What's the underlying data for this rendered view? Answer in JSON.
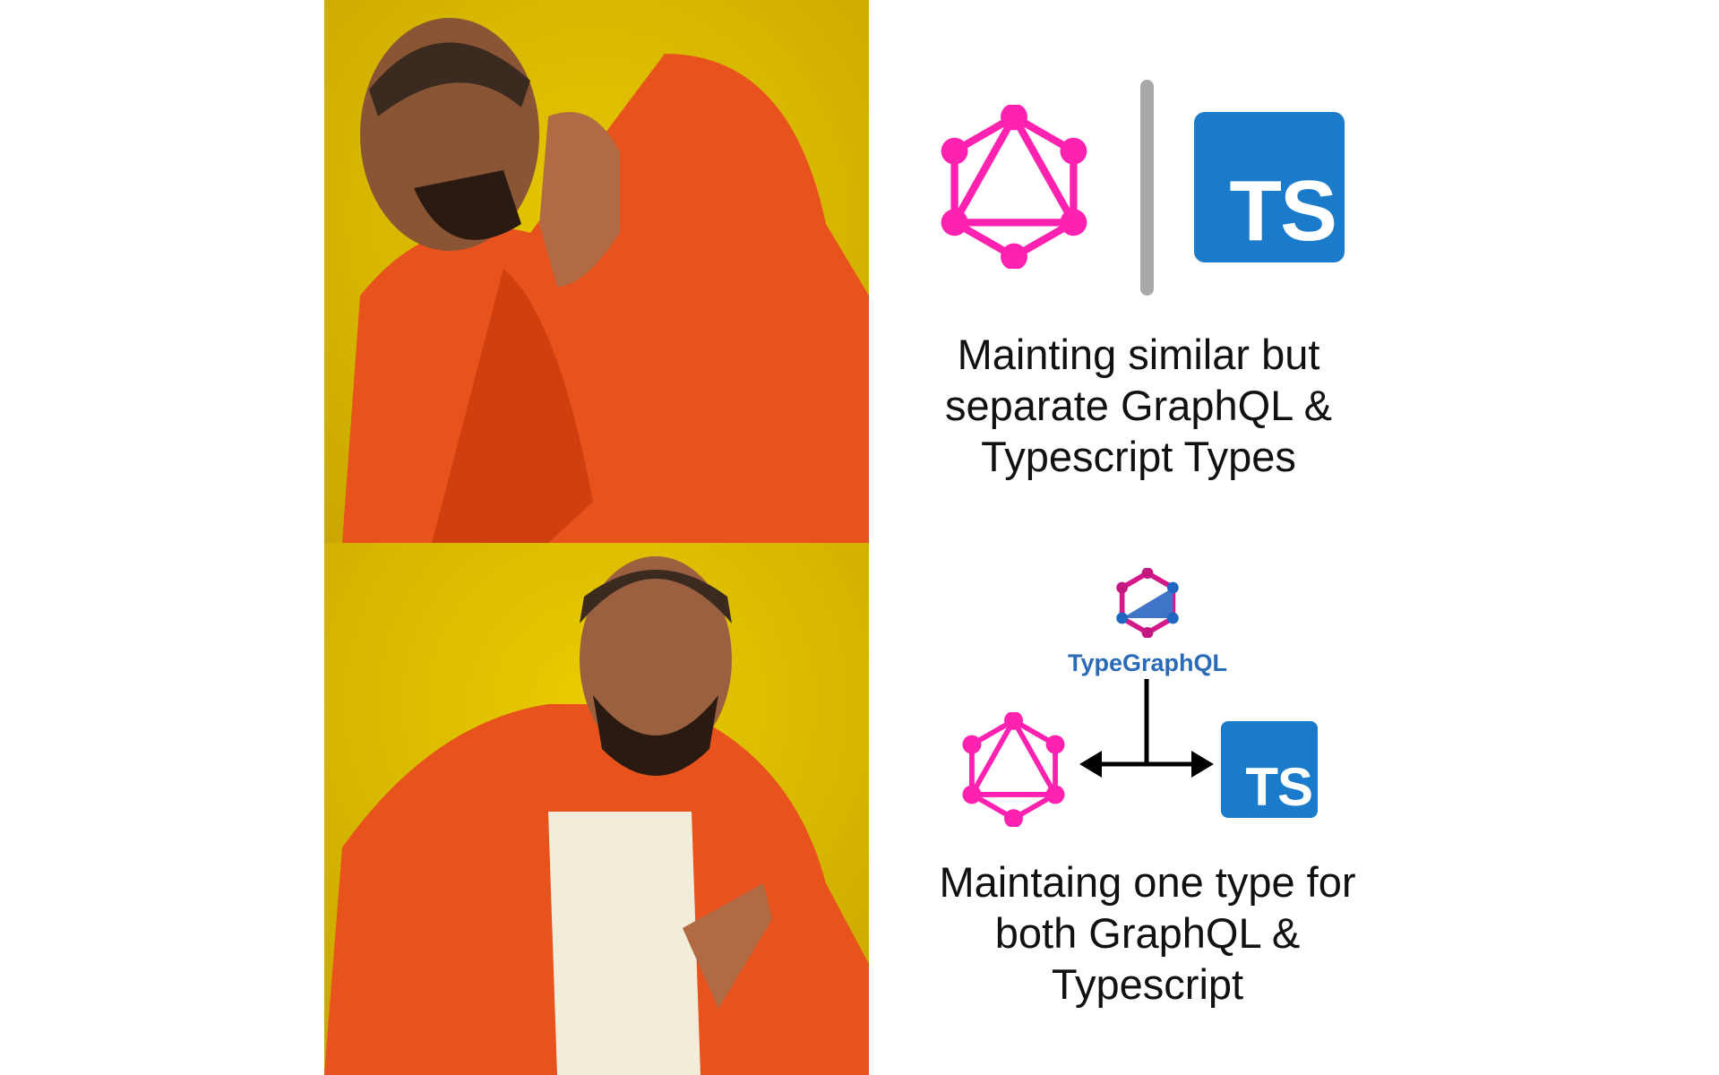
{
  "top": {
    "caption": "Mainting similar but\nseparate GraphQL &\nTypescript Types",
    "ts_label": "TS"
  },
  "bottom": {
    "logo_label": "TypeGraphQL",
    "caption": "Maintaing one type for\nboth GraphQL &\nTypescript",
    "ts_label": "TS"
  },
  "colors": {
    "graphql": "#ff22b0",
    "typescript": "#1a7bcb",
    "background": "#d8b600",
    "jacket": "#e8501a"
  }
}
